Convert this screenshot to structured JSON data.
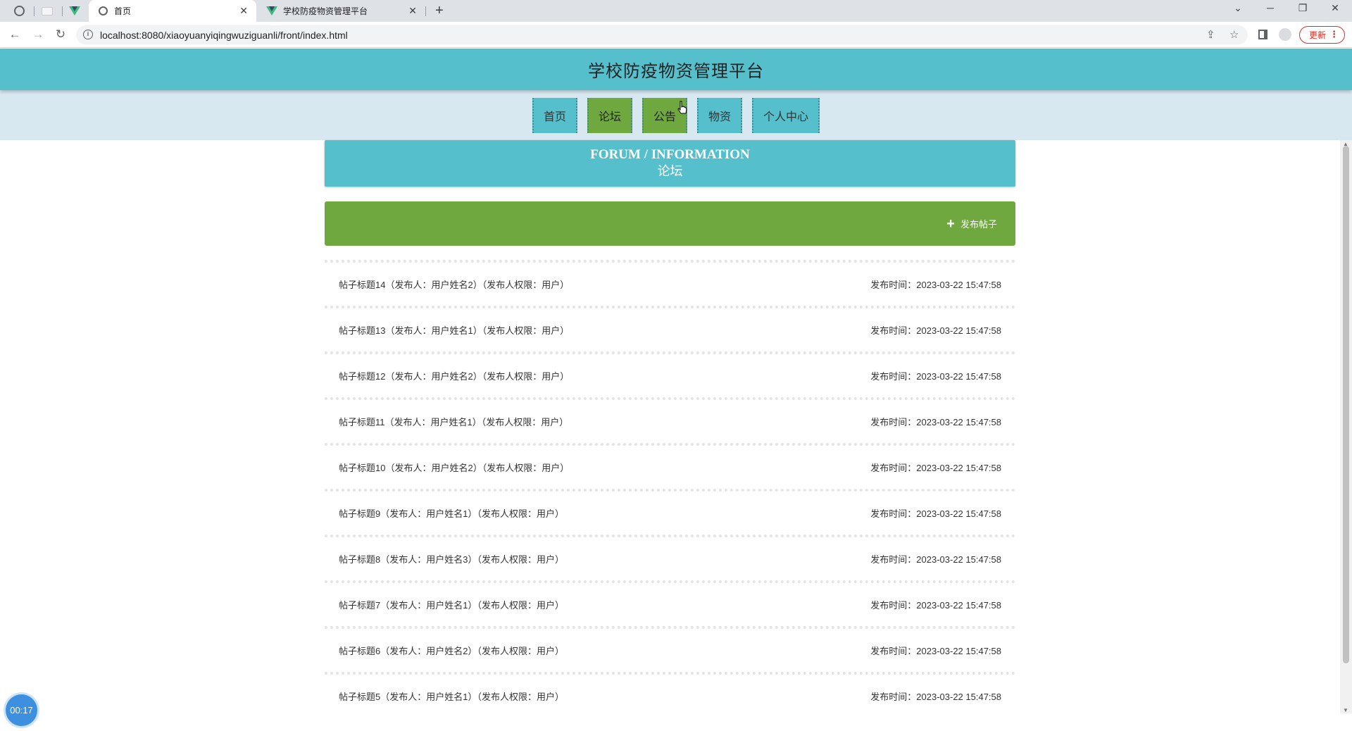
{
  "browser": {
    "tabs": [
      {
        "title": "首页",
        "active": true
      },
      {
        "title": "学校防疫物资管理平台",
        "active": false
      }
    ],
    "url": "localhost:8080/xiaoyuanyiqingwuziguanli/front/index.html",
    "update_label": "更新"
  },
  "site": {
    "title": "学校防疫物资管理平台"
  },
  "nav": {
    "items": [
      {
        "label": "首页",
        "active": false
      },
      {
        "label": "论坛",
        "active": true
      },
      {
        "label": "公告",
        "active": true
      },
      {
        "label": "物资",
        "active": false
      },
      {
        "label": "个人中心",
        "active": false
      }
    ]
  },
  "banner": {
    "en": "FORUM / INFORMATION",
    "cn": "论坛"
  },
  "actions": {
    "add_post_label": "发布帖子"
  },
  "posts": [
    {
      "title": "帖子标题14（发布人：用户姓名2）（发布人权限：用户）",
      "time": "发布时间：2023-03-22 15:47:58"
    },
    {
      "title": "帖子标题13（发布人：用户姓名1）（发布人权限：用户）",
      "time": "发布时间：2023-03-22 15:47:58"
    },
    {
      "title": "帖子标题12（发布人：用户姓名2）（发布人权限：用户）",
      "time": "发布时间：2023-03-22 15:47:58"
    },
    {
      "title": "帖子标题11（发布人：用户姓名1）（发布人权限：用户）",
      "time": "发布时间：2023-03-22 15:47:58"
    },
    {
      "title": "帖子标题10（发布人：用户姓名2）（发布人权限：用户）",
      "time": "发布时间：2023-03-22 15:47:58"
    },
    {
      "title": "帖子标题9（发布人：用户姓名1）（发布人权限：用户）",
      "time": "发布时间：2023-03-22 15:47:58"
    },
    {
      "title": "帖子标题8（发布人：用户姓名3）（发布人权限：用户）",
      "time": "发布时间：2023-03-22 15:47:58"
    },
    {
      "title": "帖子标题7（发布人：用户姓名1）（发布人权限：用户）",
      "time": "发布时间：2023-03-22 15:47:58"
    },
    {
      "title": "帖子标题6（发布人：用户姓名2）（发布人权限：用户）",
      "time": "发布时间：2023-03-22 15:47:58"
    },
    {
      "title": "帖子标题5（发布人：用户姓名1）（发布人权限：用户）",
      "time": "发布时间：2023-03-22 15:47:58"
    }
  ],
  "timer": "00:17",
  "colors": {
    "header": "#55bfcc",
    "nav_bg": "#d8e8f0",
    "accent_green": "#6fa83e"
  }
}
